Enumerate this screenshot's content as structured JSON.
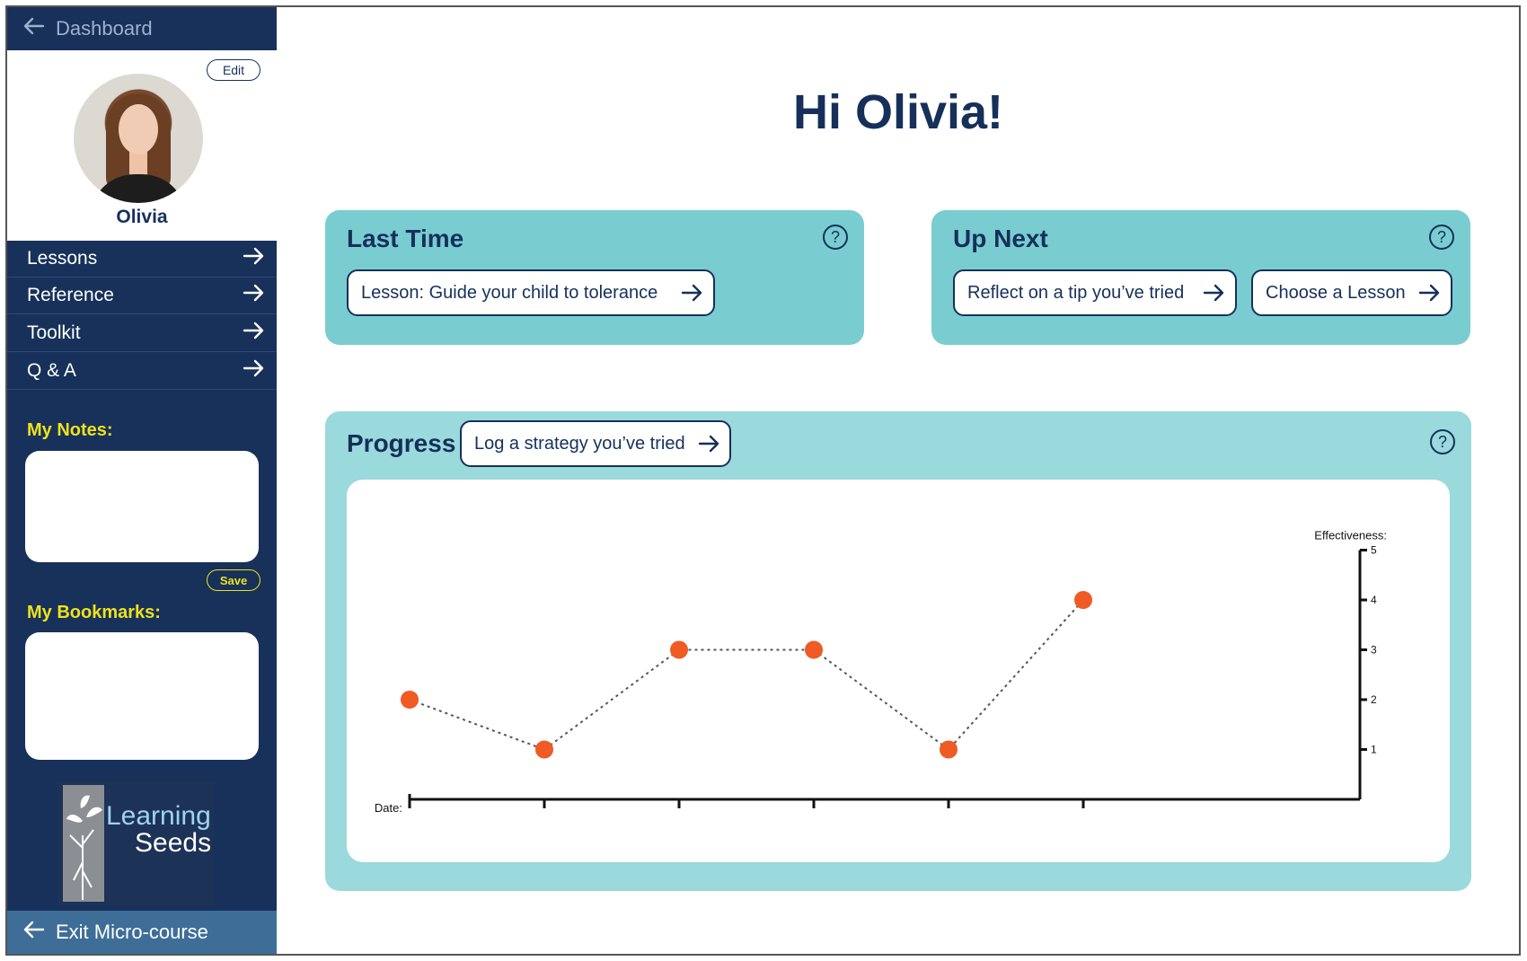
{
  "sidebar": {
    "dashboard_label": "Dashboard",
    "edit_label": "Edit",
    "profile_name": "Olivia",
    "nav": [
      {
        "label": "Lessons"
      },
      {
        "label": "Reference"
      },
      {
        "label": "Toolkit"
      },
      {
        "label": "Q & A"
      }
    ],
    "notes_label": "My Notes:",
    "notes_value": "",
    "save_label": "Save",
    "bookmarks_label": "My Bookmarks:",
    "logo_text_1": "Learning",
    "logo_text_2": "Seeds",
    "exit_label": "Exit Micro-course"
  },
  "main": {
    "greeting": "Hi Olivia!",
    "last_time": {
      "title": "Last Time",
      "button": "Lesson: Guide your child to tolerance"
    },
    "up_next": {
      "title": "Up Next",
      "buttons": [
        "Reflect on a tip you’ve tried",
        "Choose a Lesson"
      ]
    },
    "progress": {
      "title": "Progress",
      "button": "Log a strategy you’ve tried"
    }
  },
  "colors": {
    "navy": "#16305a",
    "teal_card": "#79cdd1",
    "teal_light": "#9ad9dc",
    "accent_yellow": "#f0e11d",
    "point_orange": "#f05a24",
    "exit_blue": "#3e6e98"
  },
  "icons": [
    "arrow-left-icon",
    "arrow-right-icon",
    "help-icon"
  ],
  "chart_data": {
    "type": "line",
    "xlabel": "Date:",
    "ylabel": "Effectiveness:",
    "x_categories": [
      "",
      "",
      "",
      "",
      "",
      ""
    ],
    "y_ticks": [
      "1",
      "2",
      "3",
      "4",
      "5"
    ],
    "ylim": [
      0,
      5
    ],
    "series": [
      {
        "values": [
          2,
          1,
          3,
          3,
          1,
          4
        ]
      }
    ],
    "line_style": "dotted",
    "axis_side": "right"
  }
}
